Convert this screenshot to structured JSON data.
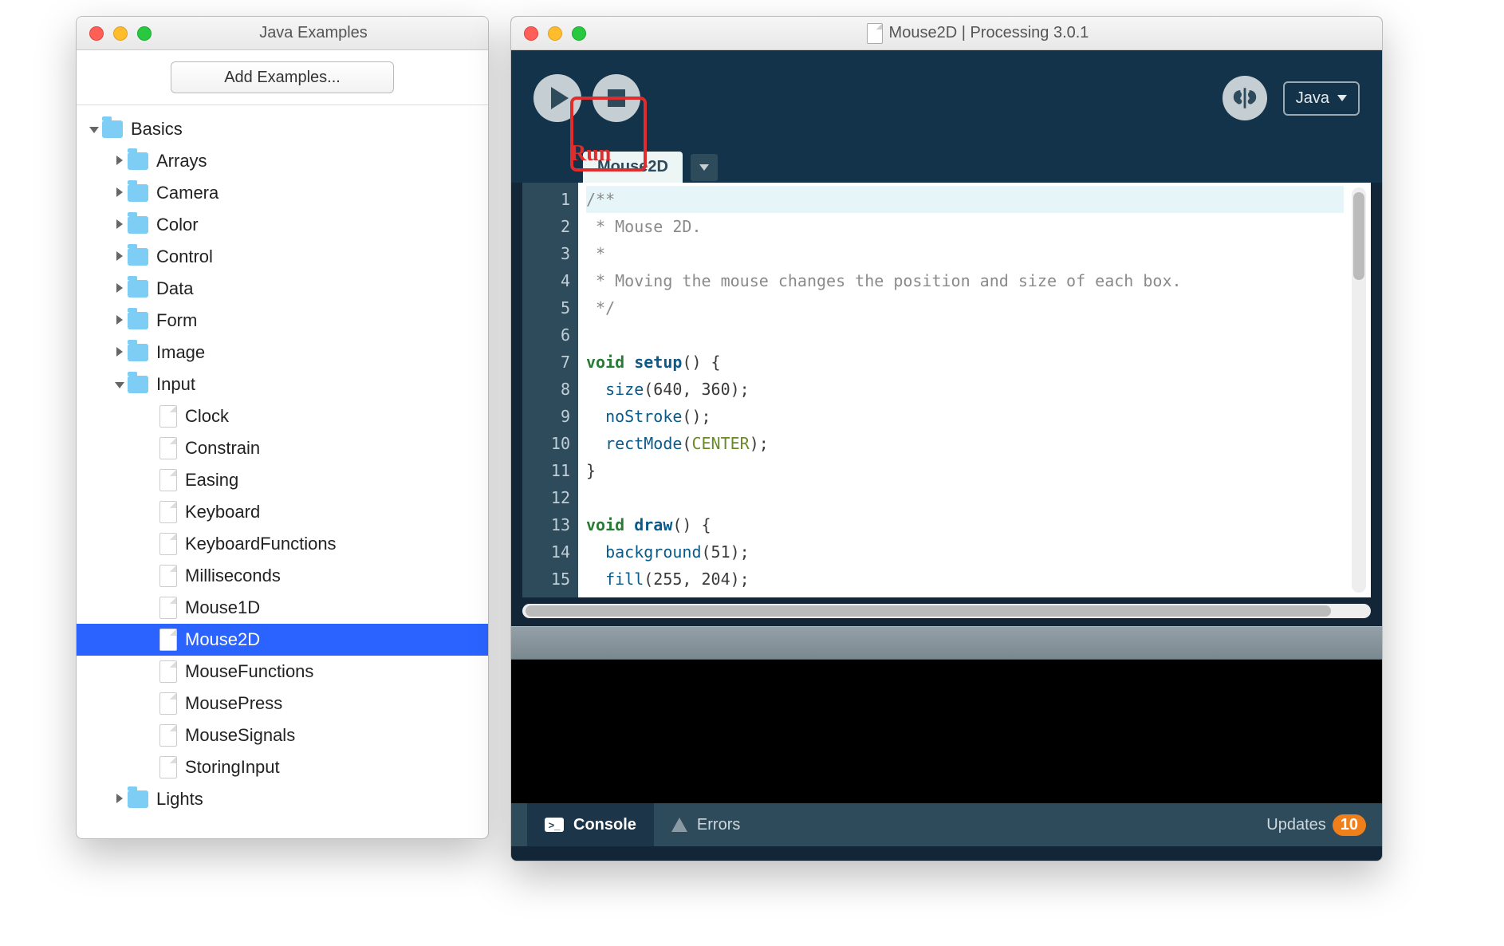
{
  "examples_window": {
    "title": "Java Examples",
    "add_button": "Add Examples...",
    "tree": {
      "basics": "Basics",
      "folders": [
        "Arrays",
        "Camera",
        "Color",
        "Control",
        "Data",
        "Form",
        "Image"
      ],
      "input_folder": "Input",
      "input_items": [
        "Clock",
        "Constrain",
        "Easing",
        "Keyboard",
        "KeyboardFunctions",
        "Milliseconds",
        "Mouse1D",
        "Mouse2D",
        "MouseFunctions",
        "MousePress",
        "MouseSignals",
        "StoringInput"
      ],
      "selected": "Mouse2D",
      "lights": "Lights"
    }
  },
  "proc_window": {
    "title": "Mouse2D | Processing 3.0.1",
    "mode": "Java",
    "tab_name": "Mouse2D",
    "annotation": "Run",
    "status": {
      "console": "Console",
      "errors": "Errors",
      "updates": "Updates",
      "update_count": "10"
    },
    "line_count": 15,
    "code": {
      "l1": "/**",
      "l2": " * Mouse 2D. ",
      "l3": " * ",
      "l4": " * Moving the mouse changes the position and size of each box. ",
      "l5": " */",
      "l6": "",
      "l7_void": "void",
      "l7_setup": "setup",
      "l7_rest": "() {",
      "l8_size": "size",
      "l8_args": "(640, 360);",
      "l9_ns": "noStroke",
      "l9_rest": "();",
      "l10_rm": "rectMode",
      "l10_open": "(",
      "l10_center": "CENTER",
      "l10_close": ");",
      "l11": "}",
      "l12": "",
      "l13_void": "void",
      "l13_draw": "draw",
      "l13_rest": "() {",
      "l14_bg": "background",
      "l14_args": "(51);",
      "l15_fill": "fill",
      "l15_args": "(255, 204);"
    }
  }
}
